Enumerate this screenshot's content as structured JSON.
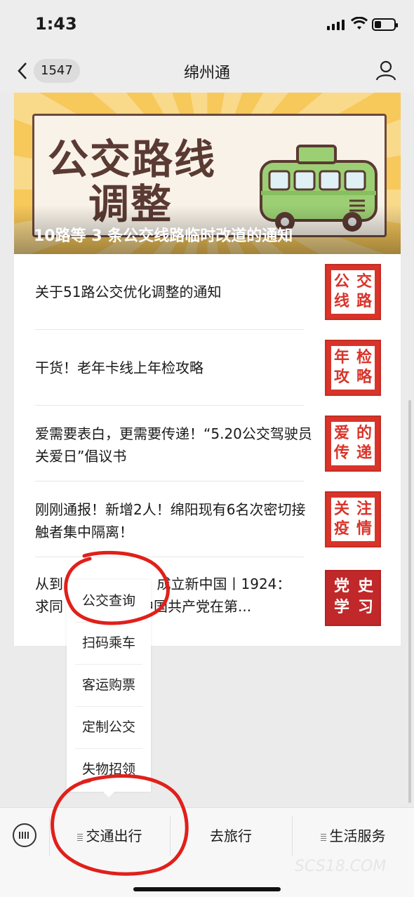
{
  "status_bar": {
    "time": "1:43"
  },
  "nav": {
    "badge": "1547",
    "title": "绵州通"
  },
  "banner": {
    "headline_line1": "公交路线",
    "headline_line2": "调整",
    "caption": "10路等 3 条公交线路临时改道的通知"
  },
  "articles": [
    {
      "title": "关于51路公交优化调整的通知",
      "thumb": [
        "公",
        "交",
        "线",
        "路"
      ]
    },
    {
      "title": "干货！老年卡线上年检攻略",
      "thumb": [
        "年",
        "检",
        "攻",
        "略"
      ]
    },
    {
      "title": "爱需要表白，更需要传递！“5.20公交驾驶员关爱日”倡议书",
      "thumb": [
        "爱",
        "的",
        "传",
        "递"
      ]
    },
    {
      "title": "刚刚通报！新增2人！绵阳现有6名次密切接触者集中隔离！",
      "thumb": [
        "关",
        "注",
        "疫",
        "情"
      ]
    },
    {
      "title_line1": "从到                     成立新中国丨1924：",
      "title_line2": "求同              —中国共产党在第...",
      "thumb": [
        "党",
        "史",
        "学",
        "习"
      ]
    }
  ],
  "popup_menu": {
    "items": [
      "公交查询",
      "扫码乘车",
      "客运购票",
      "定制公交",
      "失物招领"
    ]
  },
  "bottom_menu": {
    "tabs": [
      "交通出行",
      "去旅行",
      "生活服务"
    ]
  },
  "watermark": "SCS18.COM",
  "colors": {
    "accent_red": "#d9342a",
    "annotation_red": "#e0201a",
    "banner_brown": "#5a3a32",
    "bus_green": "#9ccf74"
  }
}
